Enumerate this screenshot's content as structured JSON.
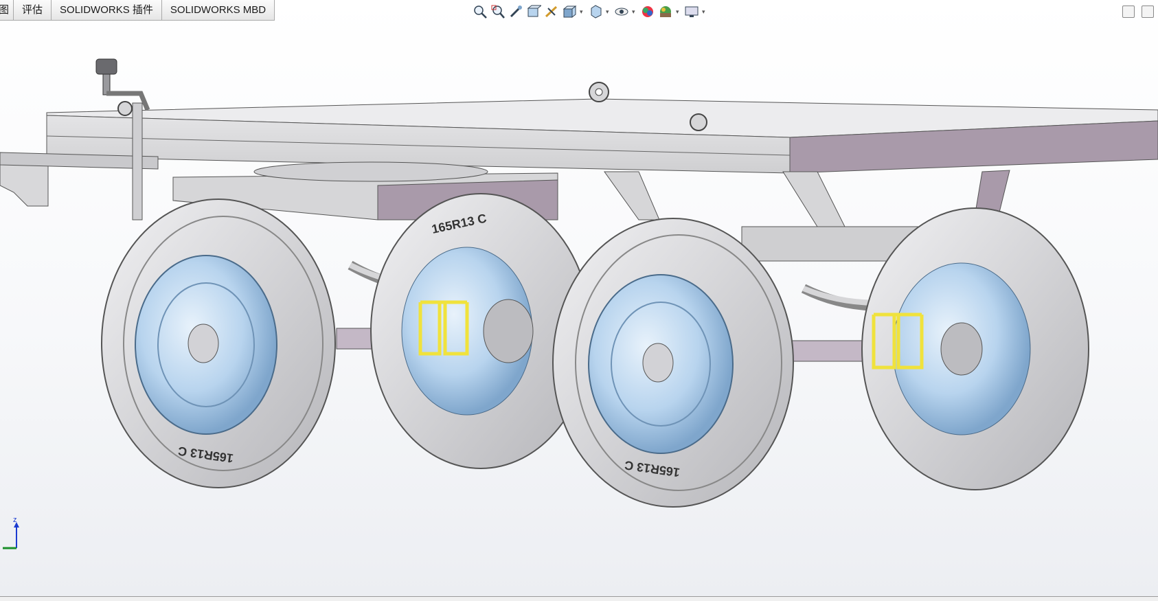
{
  "tabs": [
    {
      "label": "图"
    },
    {
      "label": "评估"
    },
    {
      "label": "SOLIDWORKS 插件"
    },
    {
      "label": "SOLIDWORKS MBD"
    }
  ],
  "view_toolbar": {
    "icons": [
      "zoom-to-fit-icon",
      "zoom-to-area-icon",
      "previous-view-icon",
      "section-view-icon",
      "dynamic-annotation-icon",
      "view-orientation-icon",
      "display-style-icon",
      "hide-show-items-icon",
      "edit-appearance-icon",
      "apply-scene-icon",
      "view-settings-icon"
    ]
  },
  "model": {
    "tire_label": "165R13 C",
    "tire_count": 4,
    "colors": {
      "frame": "#d4d4d6",
      "frame_side": "#a99aaa",
      "rim": "#b8d4ee",
      "tire": "#cfcfd2",
      "u_bolt": "#f0e23c"
    }
  },
  "triad": {
    "z_label": "z"
  }
}
